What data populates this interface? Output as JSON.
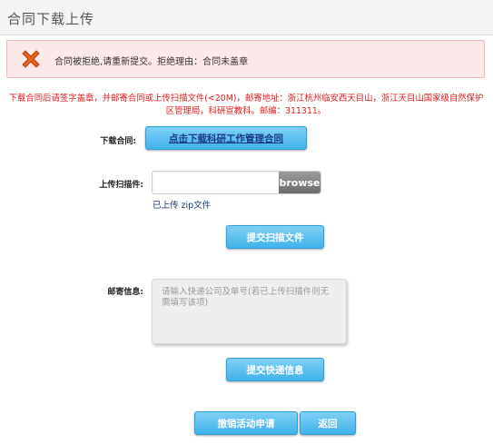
{
  "header": {
    "title": "合同下载上传"
  },
  "alert": {
    "icon": "close-x-icon",
    "message": "合同被拒绝,请重新提交。拒绝理由：合同未盖章"
  },
  "notice": "下载合同后请签字盖章，并邮寄合同或上传扫描文件(<20M)，邮寄地址：浙江杭州临安西天目山，浙江天目山国家级自然保护区管理局，科研宣教科。邮编：311311。",
  "download": {
    "label": "下载合同:",
    "button": "点击下载科研工作管理合同"
  },
  "upload": {
    "label": "上传扫描件:",
    "browse_label": "browse",
    "status": "已上传 zip文件",
    "submit_button": "提交扫描文件"
  },
  "mail": {
    "label": "邮寄信息:",
    "placeholder": "请输入快递公司及单号(若已上传扫描件则无需填写该项)",
    "submit_button": "提交快递信息"
  },
  "footer": {
    "cancel_button": "撤销活动申请",
    "back_button": "返回"
  },
  "colors": {
    "alert_bg": "#fde9ea",
    "notice_text": "#e01b1b",
    "button_blue": "#41b2ea",
    "error_icon": "#e2611f"
  }
}
